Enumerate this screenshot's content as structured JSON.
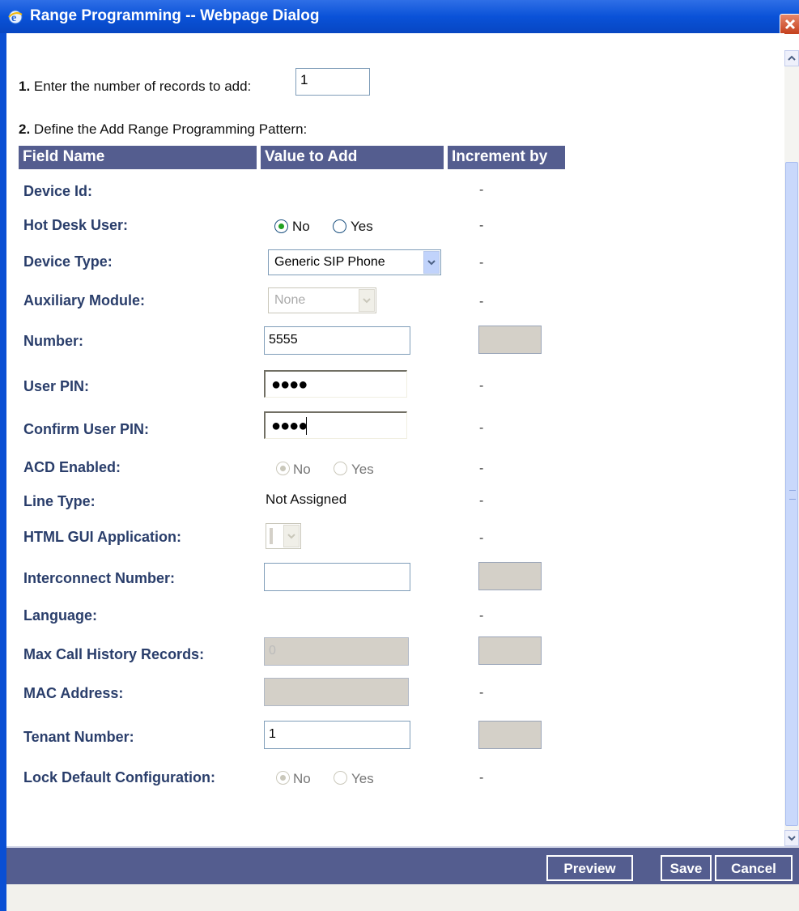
{
  "window": {
    "title": "Range Programming -- Webpage Dialog"
  },
  "step1": {
    "prefix": "1.",
    "label": " Enter the number of records to add:",
    "value": "1"
  },
  "step2": {
    "prefix": "2.",
    "label": " Define the Add Range Programming Pattern:"
  },
  "table": {
    "headers": [
      "Field Name",
      "Value to Add",
      "Increment by"
    ]
  },
  "fields": {
    "device_id": {
      "label": "Device Id:",
      "increment": "-"
    },
    "hot_desk": {
      "label": "Hot Desk User:",
      "opt_no": "No",
      "opt_yes": "Yes",
      "selected": "No",
      "increment": "-"
    },
    "device_type": {
      "label": "Device Type:",
      "value": "Generic SIP Phone",
      "increment": "-"
    },
    "aux_module": {
      "label": "Auxiliary Module:",
      "value": "None",
      "increment": "-"
    },
    "number": {
      "label": "Number:",
      "value": "5555"
    },
    "user_pin": {
      "label": "User PIN:",
      "masked": "●●●●",
      "increment": "-"
    },
    "confirm_pin": {
      "label": "Confirm User PIN:",
      "masked": "●●●●",
      "increment": "-"
    },
    "acd": {
      "label": "ACD Enabled:",
      "opt_no": "No",
      "opt_yes": "Yes",
      "selected": "No",
      "increment": "-"
    },
    "line_type": {
      "label": "Line Type:",
      "value": "Not Assigned",
      "increment": "-"
    },
    "html_gui": {
      "label": "HTML GUI Application:",
      "increment": "-"
    },
    "interconnect": {
      "label": "Interconnect Number:",
      "value": ""
    },
    "language": {
      "label": "Language:",
      "increment": "-"
    },
    "max_call_history": {
      "label": "Max Call History Records:",
      "value": "0"
    },
    "mac": {
      "label": "MAC Address:",
      "value": "",
      "increment": "-"
    },
    "tenant": {
      "label": "Tenant Number:",
      "value": "1"
    },
    "lock_default": {
      "label": "Lock Default Configuration:",
      "opt_no": "No",
      "opt_yes": "Yes",
      "selected": "No",
      "increment": "-"
    }
  },
  "buttons": {
    "preview": "Preview",
    "save": "Save",
    "cancel": "Cancel"
  }
}
